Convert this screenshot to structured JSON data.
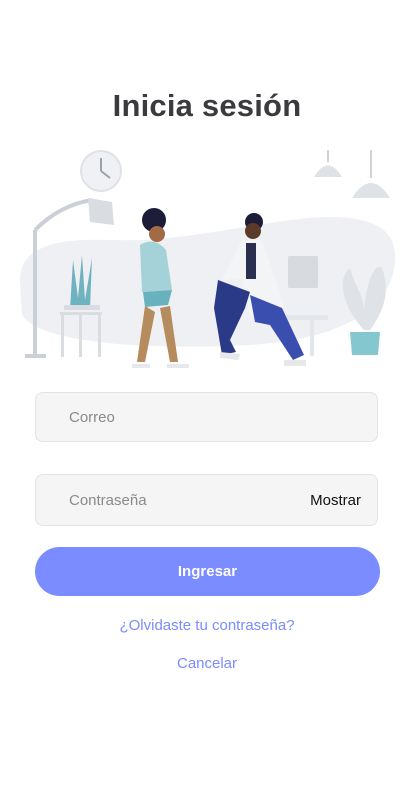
{
  "header": {
    "title": "Inicia sesión"
  },
  "form": {
    "email_placeholder": "Correo",
    "password_placeholder": "Contraseña",
    "show_label": "Mostrar",
    "submit_label": "Ingresar",
    "forgot_label": "¿Olvidaste tu contraseña?",
    "cancel_label": "Cancelar"
  },
  "colors": {
    "accent": "#7a8cff",
    "title": "#3a3a3f",
    "field_bg": "#f5f5f5",
    "field_border": "#e3e3e3"
  },
  "icons": [
    "clock-icon",
    "lamp-icon",
    "pendant-lamp-icon",
    "plant-icon"
  ]
}
